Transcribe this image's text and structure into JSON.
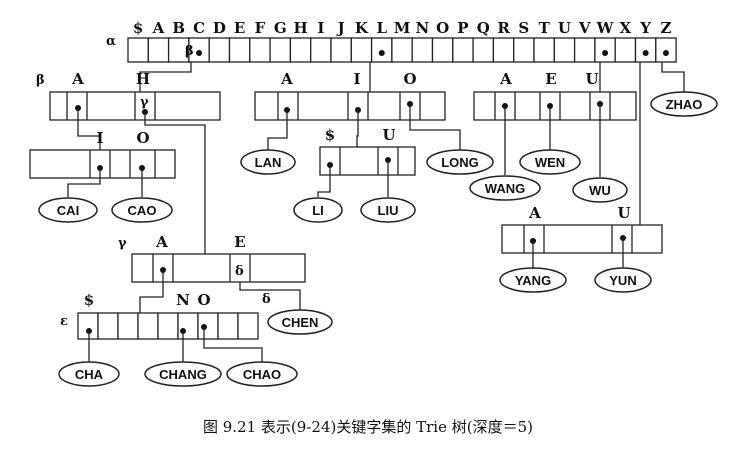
{
  "root": {
    "greek": "α",
    "letters": [
      "$",
      "A",
      "B",
      "C",
      "D",
      "E",
      "F",
      "G",
      "H",
      "I",
      "J",
      "K",
      "L",
      "M",
      "N",
      "O",
      "P",
      "Q",
      "R",
      "S",
      "T",
      "U",
      "V",
      "W",
      "X",
      "Y",
      "Z"
    ],
    "c_cell_mark": "β"
  },
  "nodes": {
    "beta": {
      "greek": "β",
      "labels": [
        "A",
        "H"
      ],
      "h_cell_mark": "γ"
    },
    "c_i": {
      "labels": [
        "I",
        "O"
      ]
    },
    "l": {
      "labels": [
        "A",
        "I",
        "O"
      ]
    },
    "li": {
      "labels": [
        "$",
        "U"
      ]
    },
    "w": {
      "labels": [
        "A",
        "E",
        "U"
      ]
    },
    "y": {
      "labels": [
        "A",
        "U"
      ]
    },
    "gamma": {
      "greek": "γ",
      "labels": [
        "A",
        "E"
      ],
      "e_cell_mark": "δ",
      "delta_pointer": "δ"
    },
    "epsilon": {
      "greek": "ε",
      "labels": [
        "$",
        "N",
        "O"
      ]
    }
  },
  "leaves": [
    "ZHAO",
    "LAN",
    "LONG",
    "WEN",
    "CAI",
    "CAO",
    "LI",
    "LIU",
    "WANG",
    "WU",
    "YANG",
    "YUN",
    "CHEN",
    "CHA",
    "CHANG",
    "CHAO"
  ],
  "caption": "图 9.21   表示(9-24)关键字集的 Trie 树(深度＝5)"
}
